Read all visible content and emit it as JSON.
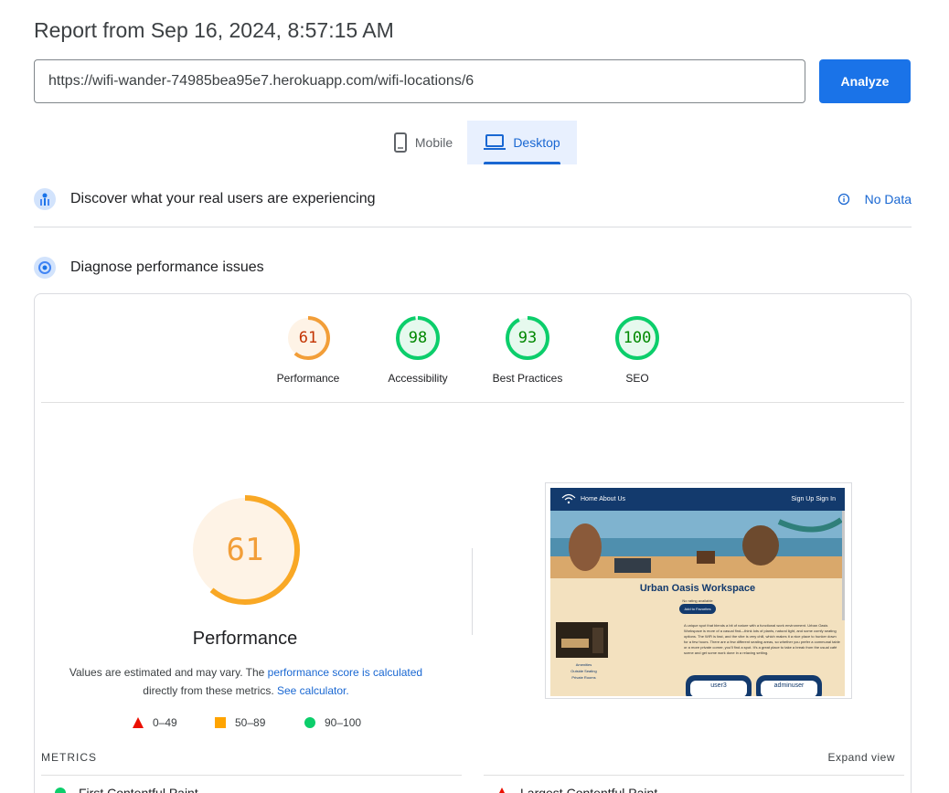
{
  "header": {
    "report_title": "Report from Sep 16, 2024, 8:57:15 AM",
    "url_value": "https://wifi-wander-74985bea95e7.herokuapp.com/wifi-locations/6",
    "analyze_label": "Analyze"
  },
  "tabs": [
    {
      "label": "Mobile",
      "icon": "phone-icon",
      "selected": false
    },
    {
      "label": "Desktop",
      "icon": "laptop-icon",
      "selected": true
    }
  ],
  "sections": {
    "real_users_label": "Discover what your real users are experiencing",
    "no_data_label": "No Data",
    "diagnose_label": "Diagnose performance issues"
  },
  "scores": [
    {
      "label": "Performance",
      "value": "61",
      "fraction": 0.61,
      "color": "#f29e38",
      "bg": "#fef3e6"
    },
    {
      "label": "Accessibility",
      "value": "98",
      "fraction": 0.98,
      "color": "#0cce6b",
      "bg": "#e6f9ee"
    },
    {
      "label": "Best Practices",
      "value": "93",
      "fraction": 0.93,
      "color": "#0cce6b",
      "bg": "#e6f9ee"
    },
    {
      "label": "SEO",
      "value": "100",
      "fraction": 1.0,
      "color": "#0cce6b",
      "bg": "#e6f9ee"
    }
  ],
  "main_score": {
    "value": "61",
    "fraction": 0.61,
    "label": "Performance",
    "desc_prefix": "Values are estimated and may vary. The ",
    "desc_link1": "performance score is calculated",
    "desc_middle": "directly from these metrics. ",
    "desc_link2": "See calculator."
  },
  "legend": [
    {
      "shape": "triangle",
      "color": "#ff4e42",
      "range": "0–49"
    },
    {
      "shape": "square",
      "color": "#ffa400",
      "range": "50–89"
    },
    {
      "shape": "circle",
      "color": "#0cce6b",
      "range": "90–100"
    }
  ],
  "thumbnail": {
    "nav_left": "Home  About Us",
    "nav_right": "Sign Up  Sign In",
    "title": "Urban Oasis Workspace",
    "rating": "No rating available",
    "fav_button": "Add to Favorites",
    "description": "A unique spot that blends a bit of nature with a functional work environment. Urban Oasis Workspace is more of a casual find—think lots of plants, natural light, and some comfy seating options. The WiFi is fast, and the vibe is very chill, which makes it a nice place to hunker down for a few hours. There are a few different seating areas, so whether you prefer a communal table or a more private corner, you'll find a spot. It's a great place to take a break from the usual café scene and get some work done in a relaxing setting.",
    "amenities": [
      "Amenities",
      "Outside Seating",
      "Private Rooms"
    ],
    "users": [
      "user3",
      "adminuser"
    ]
  },
  "metrics": {
    "section_label": "METRICS",
    "expand_label": "Expand view",
    "items": [
      {
        "label": "First Contentful Paint",
        "status": "good"
      },
      {
        "label": "Largest Contentful Paint",
        "status": "poor"
      }
    ]
  }
}
